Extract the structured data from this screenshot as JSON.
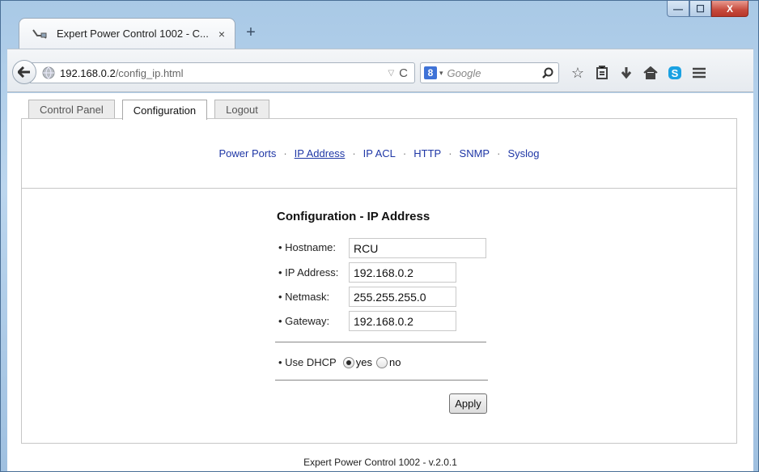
{
  "browser": {
    "tab_title": "Expert Power Control 1002 - C...",
    "tab_close": "×",
    "new_tab": "+",
    "url_host": "192.168.0.2",
    "url_path": "/config_ip.html",
    "search_engine_letter": "8",
    "search_placeholder": "Google",
    "icons": [
      "back-arrow-icon",
      "globe-icon",
      "reload-icon",
      "search-icon",
      "star-icon",
      "reading-list-icon",
      "download-icon",
      "home-icon",
      "skype-icon",
      "menu-icon"
    ],
    "window_controls": {
      "minimize": "—",
      "maximize": "☐",
      "close": "X"
    }
  },
  "page_tabs": [
    {
      "label": "Control Panel",
      "active": false
    },
    {
      "label": "Configuration",
      "active": true
    },
    {
      "label": "Logout",
      "active": false
    }
  ],
  "subnav": {
    "items": [
      "Power Ports",
      "IP Address",
      "IP ACL",
      "HTTP",
      "SNMP",
      "Syslog"
    ],
    "current": "IP Address",
    "separator": "·"
  },
  "form": {
    "title": "Configuration - IP Address",
    "hostname_label": "• Hostname:",
    "hostname_value": "RCU",
    "ip_label": "• IP Address:",
    "ip_value": "192.168.0.2",
    "netmask_label": "• Netmask:",
    "netmask_value": "255.255.255.0",
    "gateway_label": "• Gateway:",
    "gateway_value": "192.168.0.2",
    "dhcp_label": "• Use DHCP",
    "dhcp_yes": "yes",
    "dhcp_no": "no",
    "dhcp_selected": "yes",
    "apply_label": "Apply"
  },
  "footer": "Expert Power Control 1002 - v.2.0.1",
  "colors": {
    "link": "#1f37a6",
    "window_frame": "#a9c9e6",
    "close_button": "#c64a3c"
  }
}
